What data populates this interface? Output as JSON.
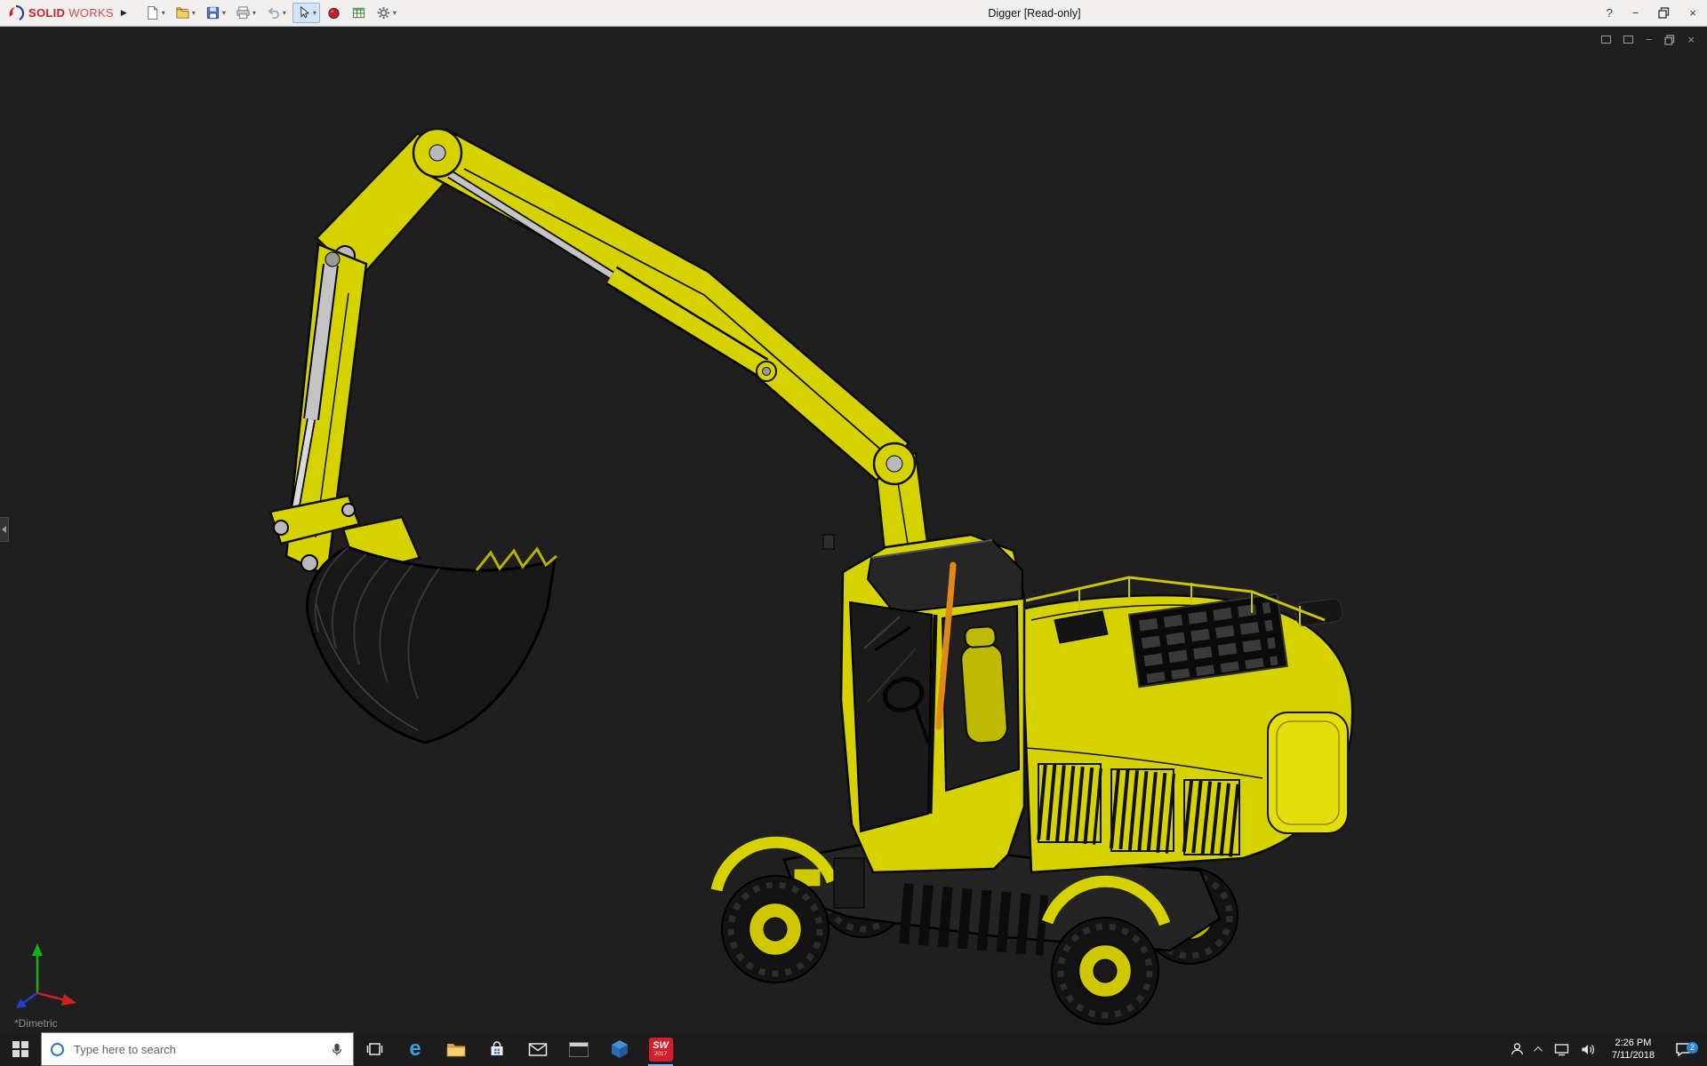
{
  "titlebar": {
    "brand_solid": "SOLID",
    "brand_works": "WORKS",
    "flyout_glyph": "▶",
    "document_title": "Digger [Read-only]",
    "help_glyph": "?",
    "minimize_glyph": "−",
    "close_glyph": "×"
  },
  "toolbar": {
    "dropdown_glyph": "▾",
    "items": [
      {
        "name": "new-document"
      },
      {
        "name": "open"
      },
      {
        "name": "save"
      },
      {
        "name": "print"
      },
      {
        "name": "undo"
      },
      {
        "name": "select-tool",
        "active": true
      },
      {
        "name": "appearance"
      },
      {
        "name": "evaluate"
      },
      {
        "name": "options"
      }
    ]
  },
  "viewport": {
    "view_label": "*Dimetric",
    "minimize_glyph": "−",
    "close_glyph": "×",
    "model": {
      "name": "Digger excavator",
      "body_color": "#d6d200",
      "outline_color": "#0a0a0a",
      "cylinder_color": "#c4c4c4",
      "hose_color": "#e08818",
      "glass_color": "#1a1a1a"
    }
  },
  "taskbar": {
    "search_placeholder": "Type here to search",
    "edge_glyph": "e",
    "app_solidworks_label": "SW",
    "app_solidworks_year": "2017",
    "clock": {
      "time": "2:26 PM",
      "date": "7/11/2018"
    },
    "notification_badge": "2"
  },
  "colors": {
    "titlebar_bg": "#f1f0ef",
    "viewport_bg": "#1f1f1f",
    "taskbar_bg": "#1c1c1c",
    "brand_red": "#cf1f2e",
    "accent_blue": "#76b9ed"
  }
}
